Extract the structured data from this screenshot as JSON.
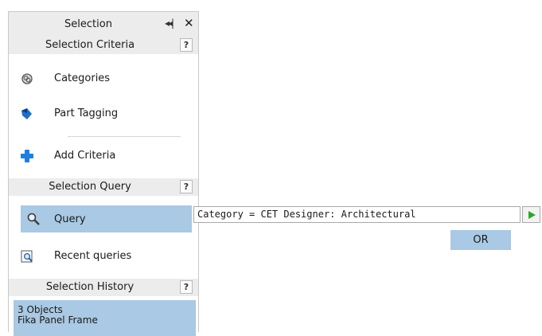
{
  "panel": {
    "title": "Selection",
    "pin_icon": "unpin-arrows-icon",
    "close_icon": "close-icon"
  },
  "sections": {
    "criteria": {
      "header": "Selection Criteria",
      "help": "?",
      "items": [
        {
          "label": "Categories",
          "icon": "categories-icon"
        },
        {
          "label": "Part Tagging",
          "icon": "tag-icon"
        },
        {
          "label": "Add Criteria",
          "icon": "plus-icon"
        }
      ]
    },
    "query": {
      "header": "Selection Query",
      "help": "?",
      "items": [
        {
          "label": "Query",
          "icon": "search-icon"
        },
        {
          "label": "Recent queries",
          "icon": "recent-search-icon"
        }
      ]
    },
    "history": {
      "header": "Selection History",
      "help": "?",
      "entry_line1": "3 Objects",
      "entry_line2": "Fika Panel Frame"
    }
  },
  "query_editor": {
    "value": "Category = CET Designer: Architectural",
    "run_icon": "play-icon",
    "or_label": "OR"
  },
  "colors": {
    "selected_bg": "#a9c9e4",
    "header_bg": "#ececec",
    "run_green": "#2fa52f",
    "plus_blue": "#1e7fe0"
  }
}
